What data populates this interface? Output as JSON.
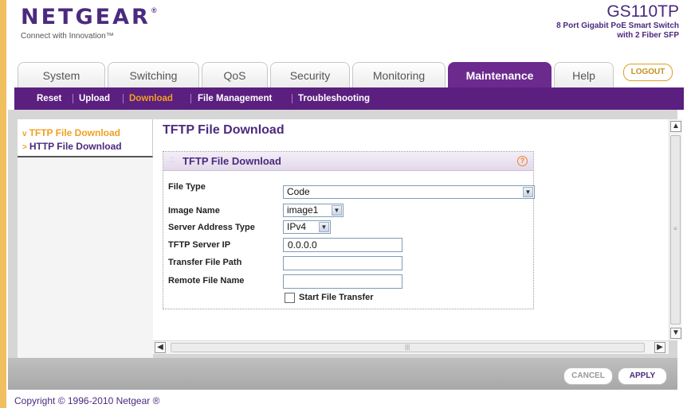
{
  "header": {
    "logo": "NETGEAR",
    "logo_mark": "®",
    "tagline": "Connect with Innovation™",
    "model": "GS110TP",
    "model_desc_line1": "8 Port Gigabit PoE Smart Switch",
    "model_desc_line2": "with 2 Fiber SFP"
  },
  "tabs": [
    {
      "label": "System"
    },
    {
      "label": "Switching"
    },
    {
      "label": "QoS"
    },
    {
      "label": "Security"
    },
    {
      "label": "Monitoring"
    },
    {
      "label": "Maintenance",
      "active": true
    },
    {
      "label": "Help"
    }
  ],
  "logout_label": "LOGOUT",
  "subnav": [
    {
      "label": "Reset"
    },
    {
      "label": "Upload"
    },
    {
      "label": "Download",
      "active": true
    },
    {
      "label": "File Management"
    },
    {
      "label": "Troubleshooting"
    }
  ],
  "leftnav": [
    {
      "label": "TFTP File Download",
      "active": true,
      "arrow": "v"
    },
    {
      "label": "HTTP File Download",
      "arrow": ">"
    }
  ],
  "page_title": "TFTP File Download",
  "panel": {
    "title": "TFTP File Download",
    "help": "?",
    "fields": {
      "file_type": {
        "label": "File Type",
        "value": "Code"
      },
      "image_name": {
        "label": "Image Name",
        "value": "image1"
      },
      "server_address_type": {
        "label": "Server Address Type",
        "value": "IPv4"
      },
      "tftp_server_ip": {
        "label": "TFTP Server IP",
        "value": "0.0.0.0"
      },
      "transfer_file_path": {
        "label": "Transfer File Path",
        "value": ""
      },
      "remote_file_name": {
        "label": "Remote File Name",
        "value": ""
      },
      "start_file_transfer": {
        "label": "Start File Transfer",
        "checked": false
      }
    }
  },
  "buttons": {
    "cancel": "CANCEL",
    "apply": "APPLY"
  },
  "footer": {
    "copyright": "Copyright © 1996-2010 Netgear ®"
  },
  "colors": {
    "brand": "#4b2a7e",
    "subnav": "#5b1f7f",
    "accent": "#f0a020"
  }
}
